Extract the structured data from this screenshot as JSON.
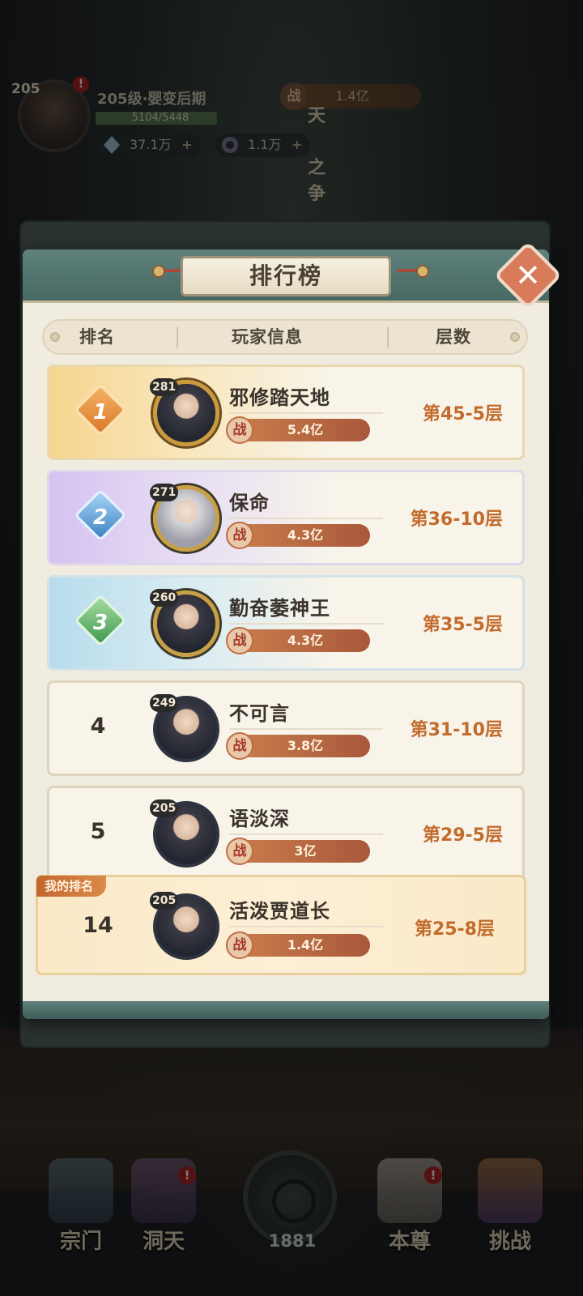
{
  "hud": {
    "level": "205",
    "alert": "!",
    "realm": "205级·婴变后期",
    "xp_text": "5104/5448",
    "xp_fraction": 0.937,
    "crystal": "37.1万",
    "spirit": "1.1万",
    "power_label": "战",
    "power": "1.4亿",
    "plus": "+",
    "event_vertical": [
      "天",
      "之",
      "争"
    ]
  },
  "modal": {
    "title": "排行榜",
    "close_label": "✕",
    "columns": {
      "rank": "排名",
      "player": "玩家信息",
      "floor": "层数"
    },
    "power_label": "战",
    "rows": [
      {
        "rank": "1",
        "level": "281",
        "name": "邪修踏天地",
        "power": "5.4亿",
        "floor": "第45-5层"
      },
      {
        "rank": "2",
        "level": "271",
        "name": "保命",
        "power": "4.3亿",
        "floor": "第36-10层"
      },
      {
        "rank": "3",
        "level": "260",
        "name": "勤奋萎神王",
        "power": "4.3亿",
        "floor": "第35-5层"
      },
      {
        "rank": "4",
        "level": "249",
        "name": "不可言",
        "power": "3.8亿",
        "floor": "第31-10层"
      },
      {
        "rank": "5",
        "level": "205",
        "name": "语淡深",
        "power": "3亿",
        "floor": "第29-5层"
      }
    ],
    "mine": {
      "tag": "我的排名",
      "rank": "14",
      "level": "205",
      "name": "活泼贾道长",
      "power": "1.4亿",
      "floor": "第25-8层"
    }
  },
  "nav": {
    "items": [
      {
        "label": "宗门",
        "icon": "sect-gate-icon"
      },
      {
        "label": "洞天",
        "icon": "cave-tree-icon",
        "alert": "!"
      },
      {
        "label": "本尊",
        "icon": "hero-portrait-icon",
        "alert": "!"
      },
      {
        "label": "挑战",
        "icon": "challenge-sword-icon"
      }
    ],
    "center_count": "1881"
  },
  "colors": {
    "accent_orange": "#c26b2c",
    "panel_teal": "#5f827d",
    "panel_bg": "#f1ece0",
    "rank1": "#d97a2c",
    "rank2": "#3e84c4",
    "rank3": "#3f9a52"
  }
}
